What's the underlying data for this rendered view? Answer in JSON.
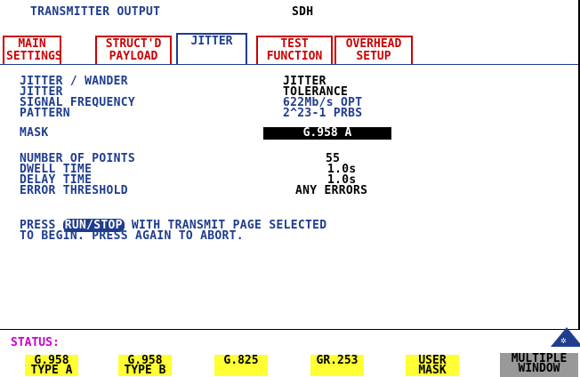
{
  "header": {
    "title": "TRANSMITTER OUTPUT",
    "mode": "SDH"
  },
  "tabs": [
    {
      "line1": "MAIN",
      "line2": "SETTINGS"
    },
    {
      "line1": "STRUCT'D",
      "line2": "PAYLOAD"
    },
    {
      "line1": "JITTER",
      "line2": ""
    },
    {
      "line1": "TEST",
      "line2": "FUNCTION"
    },
    {
      "line1": "OVERHEAD",
      "line2": "SETUP"
    }
  ],
  "settings": [
    {
      "label": "JITTER / WANDER",
      "value": "JITTER"
    },
    {
      "label": "JITTER",
      "value": "TOLERANCE"
    },
    {
      "label": "SIGNAL FREQUENCY",
      "value": "622Mb/s OPT"
    },
    {
      "label": "PATTERN",
      "value": "2^23-1 PRBS"
    },
    {
      "label": "MASK",
      "value": "G.958 A"
    }
  ],
  "params": [
    {
      "label": "NUMBER OF POINTS",
      "value": "55"
    },
    {
      "label": "DWELL TIME",
      "value": "1.0s"
    },
    {
      "label": "DELAY TIME",
      "value": "1.0s"
    },
    {
      "label": "ERROR THRESHOLD",
      "value": "ANY ERRORS"
    }
  ],
  "instructions": {
    "pre": "PRESS ",
    "key": "RUN/STOP",
    "post": " WITH TRANSMIT PAGE SELECTED",
    "line2": "TO BEGIN. PRESS AGAIN TO ABORT."
  },
  "status_label": "STATUS:",
  "softkeys": [
    {
      "line1": "G.958",
      "line2": "TYPE A"
    },
    {
      "line1": "G.958",
      "line2": "TYPE B"
    },
    {
      "line1": "G.825",
      "line2": ""
    },
    {
      "line1": "GR.253",
      "line2": ""
    },
    {
      "line1": "USER",
      "line2": "MASK"
    },
    {
      "line1": "MULTIPLE",
      "line2": "WINDOW"
    }
  ],
  "colors": {
    "accent": "#1f3c8f",
    "tab_red": "#cc0000",
    "softkey": "#ffff33",
    "status": "#cc00cc"
  }
}
